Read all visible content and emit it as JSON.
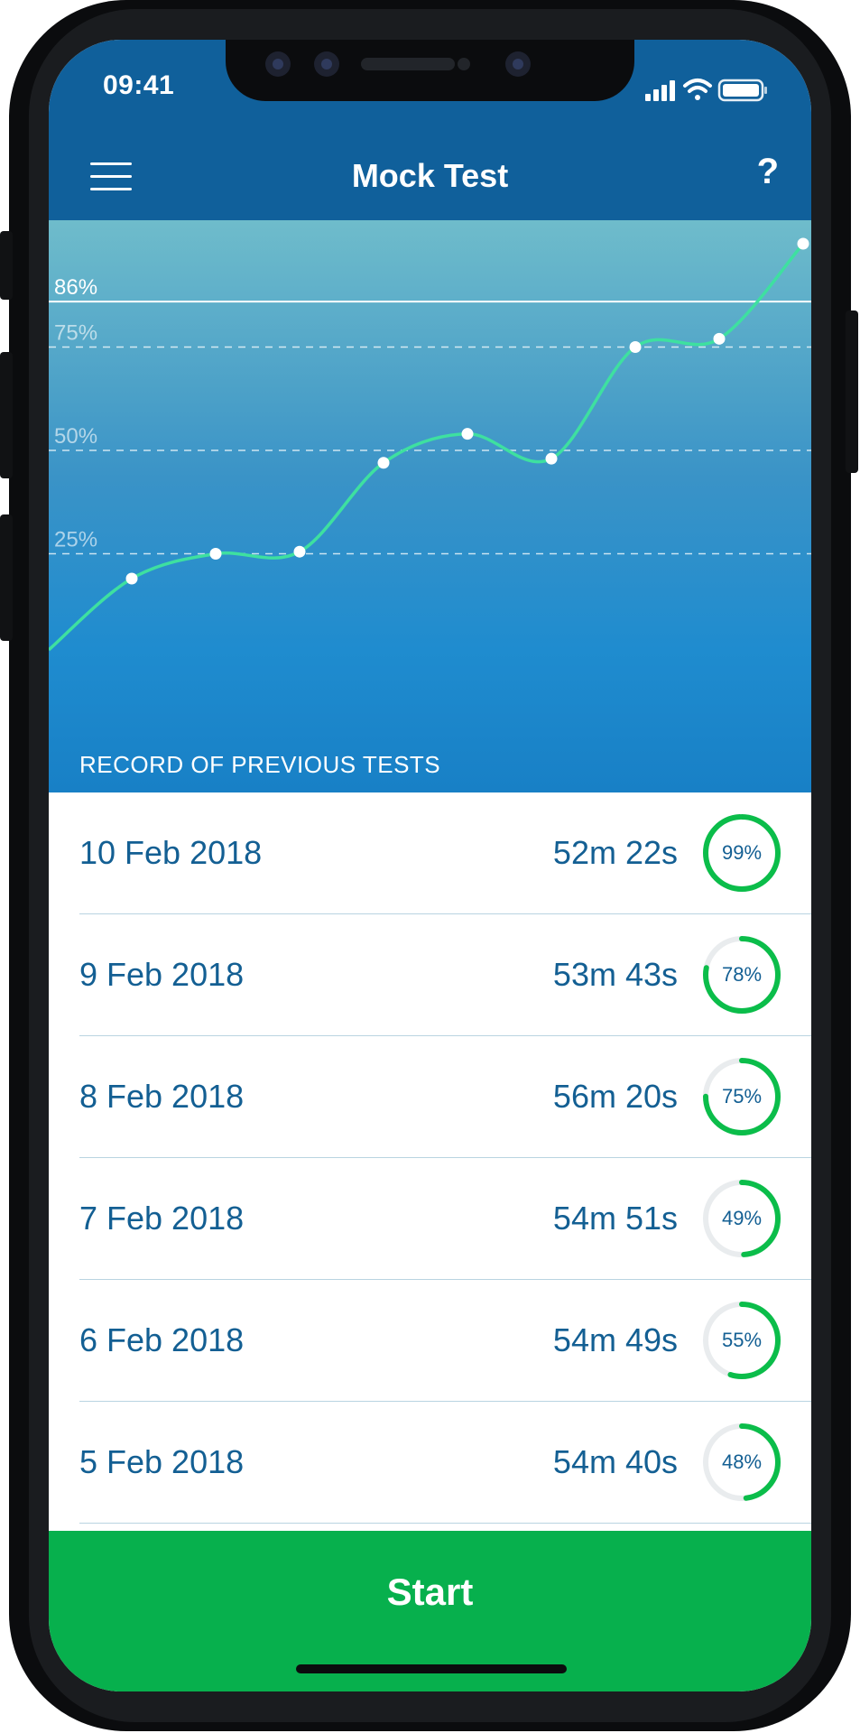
{
  "status_bar": {
    "time": "09:41"
  },
  "header": {
    "title": "Mock Test",
    "help": "?"
  },
  "chart_data": {
    "type": "line",
    "x": [
      1,
      2,
      3,
      4,
      5,
      6,
      7,
      8,
      9
    ],
    "values": [
      19,
      25,
      25.5,
      47,
      54,
      48,
      75,
      77,
      100
    ],
    "ylim": [
      0,
      100
    ],
    "gridlines": [
      {
        "label": "25%",
        "value": 25
      },
      {
        "label": "50%",
        "value": 50
      },
      {
        "label": "75%",
        "value": 75
      }
    ],
    "target": {
      "label": "86%",
      "value": 86
    },
    "line_color": "#3ee0a0"
  },
  "records": {
    "section_label": "RECORD OF PREVIOUS TESTS",
    "items": [
      {
        "date": "10 Feb 2018",
        "duration": "52m 22s",
        "score": "99%",
        "progress": 0.99
      },
      {
        "date": "9 Feb 2018",
        "duration": "53m 43s",
        "score": "78%",
        "progress": 0.78
      },
      {
        "date": "8 Feb 2018",
        "duration": "56m 20s",
        "score": "75%",
        "progress": 0.75
      },
      {
        "date": "7 Feb 2018",
        "duration": "54m 51s",
        "score": "49%",
        "progress": 0.49
      },
      {
        "date": "6 Feb 2018",
        "duration": "54m 49s",
        "score": "55%",
        "progress": 0.55
      },
      {
        "date": "5 Feb 2018",
        "duration": "54m 40s",
        "score": "48%",
        "progress": 0.48
      }
    ]
  },
  "actions": {
    "start_label": "Start"
  },
  "colors": {
    "header": "#10609b",
    "accent": "#07b04d",
    "text": "#135f93",
    "ring": "#0bbd4a"
  }
}
